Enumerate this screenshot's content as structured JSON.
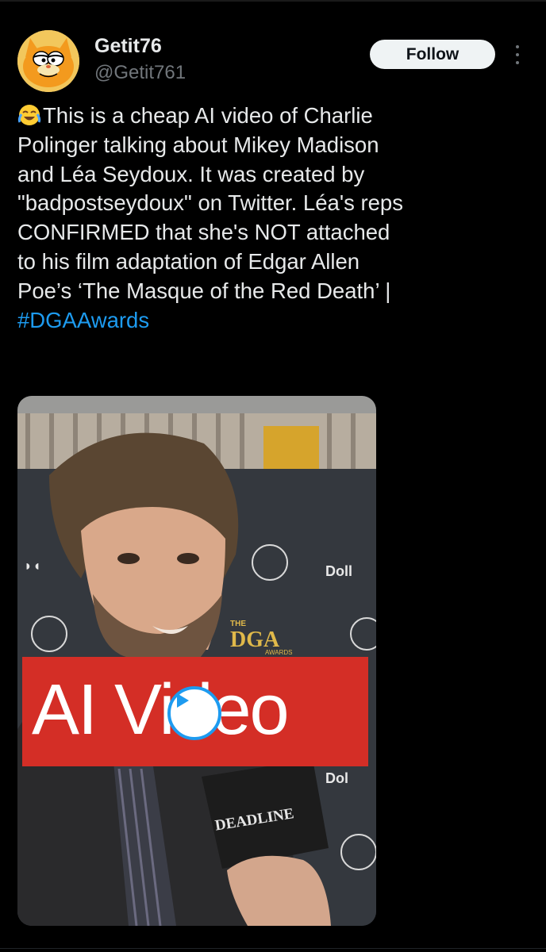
{
  "post": {
    "author_name": "Getit76",
    "author_handle": "@Getit761",
    "follow_label": "Follow",
    "text_lines": [
      "This is a cheap AI video of Charlie",
      "Polinger talking about Mikey Madison",
      "and Léa Seydoux. It was created by",
      "\"badpostseydoux\" on Twitter. Léa's reps",
      "CONFIRMED that she's NOT attached",
      "to his film adaptation of Edgar Allen",
      "Poe’s ‘The Masque of the Red Death’ |"
    ],
    "hashtag": "#DGAAwards",
    "leading_emoji": "face-with-tears-of-joy"
  },
  "media": {
    "banner_text": "AI Video",
    "mic_flag_text": "DEADLINE",
    "backdrop_logo_1": "DGA",
    "backdrop_logo_sub": "AWARDS",
    "backdrop_logo_the": "THE",
    "sponsor_1": "Doll",
    "sponsor_2": "Dol",
    "play_icon": "play-icon"
  },
  "colors": {
    "background": "#000000",
    "text": "#e7e9ea",
    "secondary": "#71767b",
    "link": "#1d9bf0",
    "banner_red": "#d42e26"
  }
}
